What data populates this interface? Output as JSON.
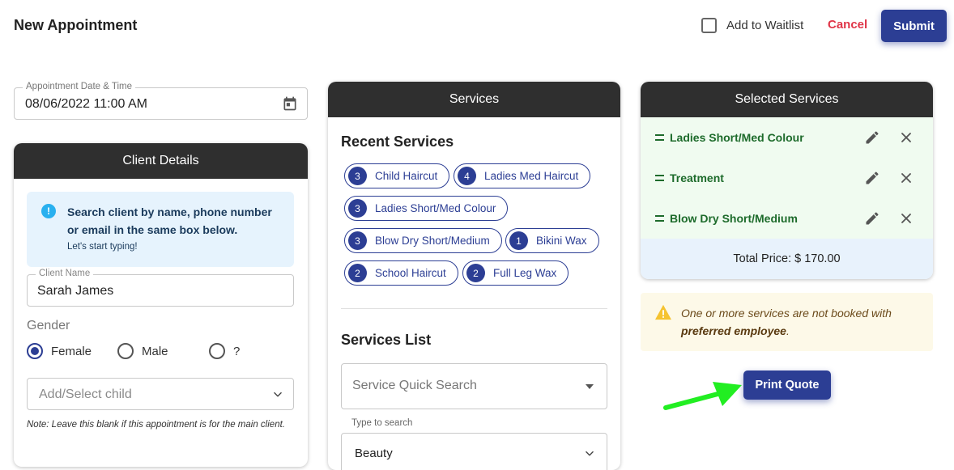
{
  "header": {
    "title": "New Appointment",
    "waitlist_label": "Add to Waitlist",
    "cancel_label": "Cancel",
    "submit_label": "Submit"
  },
  "appointment": {
    "label": "Appointment Date & Time",
    "value": "08/06/2022 11:00 AM"
  },
  "client": {
    "header": "Client Details",
    "info_text": "Search client by name, phone number or email in the same box below.",
    "info_sub": "Let's start typing!",
    "name_label": "Client Name",
    "name_value": "Sarah James",
    "gender_label": "Gender",
    "genders": [
      {
        "label": "Female",
        "selected": true
      },
      {
        "label": "Male",
        "selected": false
      },
      {
        "label": "?",
        "selected": false
      }
    ],
    "child_placeholder": "Add/Select child",
    "note": "Note: Leave this blank if this appointment is for the main client."
  },
  "services": {
    "header": "Services",
    "recent_title": "Recent Services",
    "recent": [
      {
        "count": "3",
        "name": "Child Haircut"
      },
      {
        "count": "4",
        "name": "Ladies Med Haircut"
      },
      {
        "count": "3",
        "name": "Ladies Short/Med Colour"
      },
      {
        "count": "3",
        "name": "Blow Dry Short/Medium"
      },
      {
        "count": "1",
        "name": "Bikini Wax"
      },
      {
        "count": "2",
        "name": "School Haircut"
      },
      {
        "count": "2",
        "name": "Full Leg Wax"
      }
    ],
    "list_title": "Services List",
    "search_placeholder": "Service Quick Search",
    "helper": "Type to search",
    "category_value": "Beauty"
  },
  "selected": {
    "header": "Selected Services",
    "items": [
      "Ladies Short/Med Colour",
      "Treatment",
      "Blow Dry Short/Medium"
    ],
    "total": "Total Price: $ 170.00"
  },
  "warning": {
    "text": "One or more services are not booked with",
    "bold": "preferred employee",
    "suffix": "."
  },
  "print_label": "Print Quote",
  "colors": {
    "primary": "#2c3e94",
    "danger": "#e03548",
    "card_header": "#2f2f2f",
    "selected_bg": "#f0fbf0",
    "selected_text": "#1d6b2b",
    "info_bg": "#e6f3fd",
    "warning_bg": "#fdf9e8",
    "arrow": "#22ee22"
  }
}
